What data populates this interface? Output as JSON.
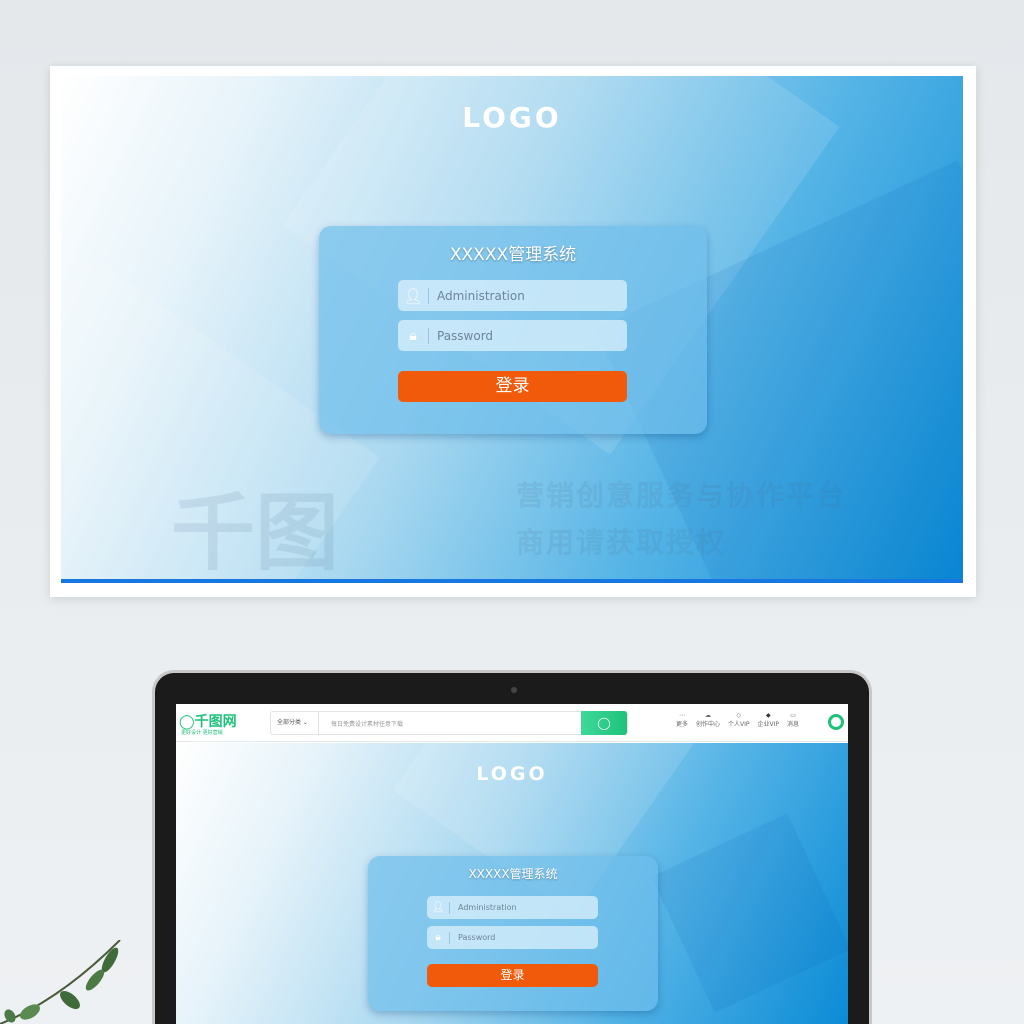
{
  "top": {
    "logo": "LOGO",
    "title": "XXXXX管理系统",
    "username_placeholder": "Administration",
    "password_placeholder": "Password",
    "login_label": "登录",
    "watermark_line1": "营销创意服务与协作平台",
    "watermark_line2": "商用请获取授权",
    "watermark_brand": "千图"
  },
  "site_header": {
    "brand": "千图网",
    "slogan": "更好设计 更好营销",
    "category": "全部分类",
    "search_placeholder": "每日免费设计素材任意下载",
    "nav": [
      {
        "label": "更多",
        "icon": "more-icon"
      },
      {
        "label": "创作中心",
        "icon": "upload-icon"
      },
      {
        "label": "个人VIP",
        "icon": "diamond-icon"
      },
      {
        "label": "企业VIP",
        "icon": "diamond-dark-icon"
      },
      {
        "label": "消息",
        "icon": "message-icon"
      }
    ]
  },
  "screen": {
    "logo": "LOGO",
    "title": "XXXXX管理系统",
    "username_placeholder": "Administration",
    "password_placeholder": "Password",
    "login_label": "登录"
  },
  "colors": {
    "accent": "#f25a0b",
    "brand_green": "#1ec27a",
    "bg_blue": "#0b8bd6"
  }
}
